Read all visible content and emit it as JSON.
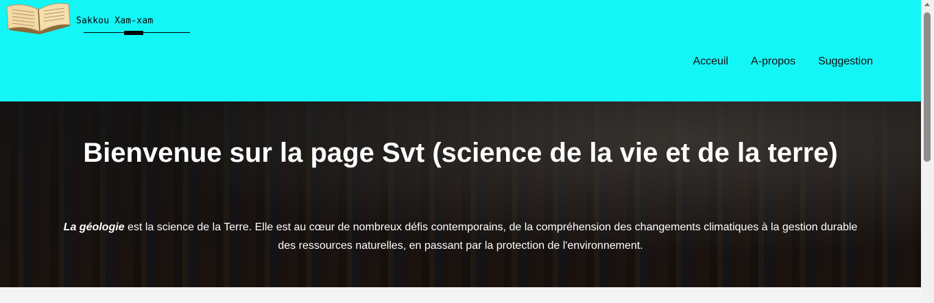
{
  "header": {
    "brand": "Sakkou Xam-xam",
    "bg_color": "#14f5f5",
    "nav": [
      {
        "label": "Acceuil"
      },
      {
        "label": "A-propos"
      },
      {
        "label": "Suggestion"
      }
    ]
  },
  "hero": {
    "title": "Bienvenue sur la page Svt (science de la vie et de la terre)",
    "paragraph_emphasis": "La géologie",
    "paragraph_rest": " est la science de la Terre. Elle est au cœur de nombreux défis contemporains, de la compréhension des changements climatiques à la gestion durable des ressources naturelles, en passant par la protection de l'environnement."
  },
  "icons": {
    "logo": "open-book-icon"
  }
}
